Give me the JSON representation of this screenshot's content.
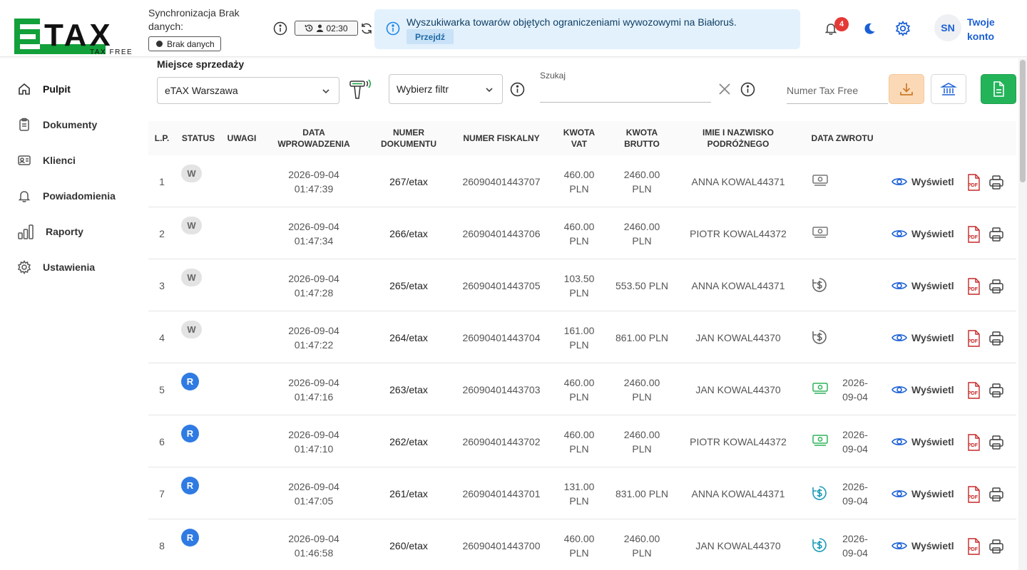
{
  "brand": {
    "logo_text": "ETAX",
    "logo_sub": "TAX FREE",
    "green": "#12a03a"
  },
  "sidebar": {
    "items": [
      {
        "label": "Pulpit",
        "icon": "home-icon"
      },
      {
        "label": "Dokumenty",
        "icon": "clipboard-icon"
      },
      {
        "label": "Klienci",
        "icon": "id-card-icon"
      },
      {
        "label": "Powiadomienia",
        "icon": "bell-icon"
      },
      {
        "label": "Raporty",
        "icon": "bar-chart-icon"
      },
      {
        "label": "Ustawienia",
        "icon": "gear-icon"
      }
    ]
  },
  "header": {
    "sync_text": "Synchronizacja Brak danych:",
    "sync_badge": "Brak danych",
    "timer": "02:30",
    "banner_text": "Wyszukiwarka towarów objętych ograniczeniami wywozowymi na Białoruś.",
    "banner_button": "Przejdź",
    "notifications_count": "4",
    "avatar_initials": "SN",
    "account_label": "Twoje konto"
  },
  "filters": {
    "place_label": "Miejsce sprzedaży",
    "place_value": "eTAX Warszawa",
    "filter_value": "Wybierz filtr",
    "search_label": "Szukaj",
    "search_value": "",
    "taxfree_placeholder": "Numer Tax Free"
  },
  "table": {
    "headers": {
      "lp": "L.P.",
      "status": "STATUS",
      "uwagi": "UWAGI",
      "data_wpr": "DATA WPROWADZENIA",
      "numer_dok": "NUMER DOKUMENTU",
      "numer_fisk": "NUMER FISKALNY",
      "kwota_vat": "KWOTA VAT",
      "kwota_brutto": "KWOTA BRUTTO",
      "podrozny": "IMIE I NAZWISKO PODRÓŻNEGO",
      "data_zwrotu": "DATA ZWROTU"
    },
    "view_label": "Wyświetl",
    "rows": [
      {
        "lp": "1",
        "status": "W",
        "date": "2026-09-04",
        "time": "01:47:39",
        "doc": "267/etax",
        "fiscal": "26090401443707",
        "vat": "460.00",
        "vat_cur": "PLN",
        "gross": "2460.00",
        "gross_cur": "PLN",
        "name": "ANNA KOWAL44371",
        "refund_icon": "cash-icon",
        "refund_color": "#777777",
        "refund_d1": "",
        "refund_d2": ""
      },
      {
        "lp": "2",
        "status": "W",
        "date": "2026-09-04",
        "time": "01:47:34",
        "doc": "266/etax",
        "fiscal": "26090401443706",
        "vat": "460.00",
        "vat_cur": "PLN",
        "gross": "2460.00",
        "gross_cur": "PLN",
        "name": "PIOTR KOWAL44372",
        "refund_icon": "cash-icon",
        "refund_color": "#777777",
        "refund_d1": "",
        "refund_d2": ""
      },
      {
        "lp": "3",
        "status": "W",
        "date": "2026-09-04",
        "time": "01:47:28",
        "doc": "265/etax",
        "fiscal": "26090401443705",
        "vat": "103.50",
        "vat_cur": "PLN",
        "gross": "553.50 PLN",
        "gross_cur": "",
        "name": "ANNA KOWAL44371",
        "refund_icon": "dollar-circle-icon",
        "refund_color": "#666666",
        "refund_d1": "",
        "refund_d2": ""
      },
      {
        "lp": "4",
        "status": "W",
        "date": "2026-09-04",
        "time": "01:47:22",
        "doc": "264/etax",
        "fiscal": "26090401443704",
        "vat": "161.00",
        "vat_cur": "PLN",
        "gross": "861.00 PLN",
        "gross_cur": "",
        "name": "JAN KOWAL44370",
        "refund_icon": "dollar-circle-icon",
        "refund_color": "#666666",
        "refund_d1": "",
        "refund_d2": ""
      },
      {
        "lp": "5",
        "status": "R",
        "date": "2026-09-04",
        "time": "01:47:16",
        "doc": "263/etax",
        "fiscal": "26090401443703",
        "vat": "460.00",
        "vat_cur": "PLN",
        "gross": "2460.00",
        "gross_cur": "PLN",
        "name": "JAN KOWAL44370",
        "refund_icon": "cash-icon",
        "refund_color": "#2eb35a",
        "refund_d1": "2026-",
        "refund_d2": "09-04"
      },
      {
        "lp": "6",
        "status": "R",
        "date": "2026-09-04",
        "time": "01:47:10",
        "doc": "262/etax",
        "fiscal": "26090401443702",
        "vat": "460.00",
        "vat_cur": "PLN",
        "gross": "2460.00",
        "gross_cur": "PLN",
        "name": "PIOTR KOWAL44372",
        "refund_icon": "cash-icon",
        "refund_color": "#2eb35a",
        "refund_d1": "2026-",
        "refund_d2": "09-04"
      },
      {
        "lp": "7",
        "status": "R",
        "date": "2026-09-04",
        "time": "01:47:05",
        "doc": "261/etax",
        "fiscal": "26090401443701",
        "vat": "131.00",
        "vat_cur": "PLN",
        "gross": "831.00 PLN",
        "gross_cur": "",
        "name": "ANNA KOWAL44371",
        "refund_icon": "dollar-circle-icon",
        "refund_color": "#1a9bb8",
        "refund_d1": "2026-",
        "refund_d2": "09-04"
      },
      {
        "lp": "8",
        "status": "R",
        "date": "2026-09-04",
        "time": "01:46:58",
        "doc": "260/etax",
        "fiscal": "26090401443700",
        "vat": "460.00",
        "vat_cur": "PLN",
        "gross": "2460.00",
        "gross_cur": "PLN",
        "name": "JAN KOWAL44370",
        "refund_icon": "dollar-circle-icon",
        "refund_color": "#1a9bb8",
        "refund_d1": "2026-",
        "refund_d2": "09-04"
      }
    ]
  }
}
